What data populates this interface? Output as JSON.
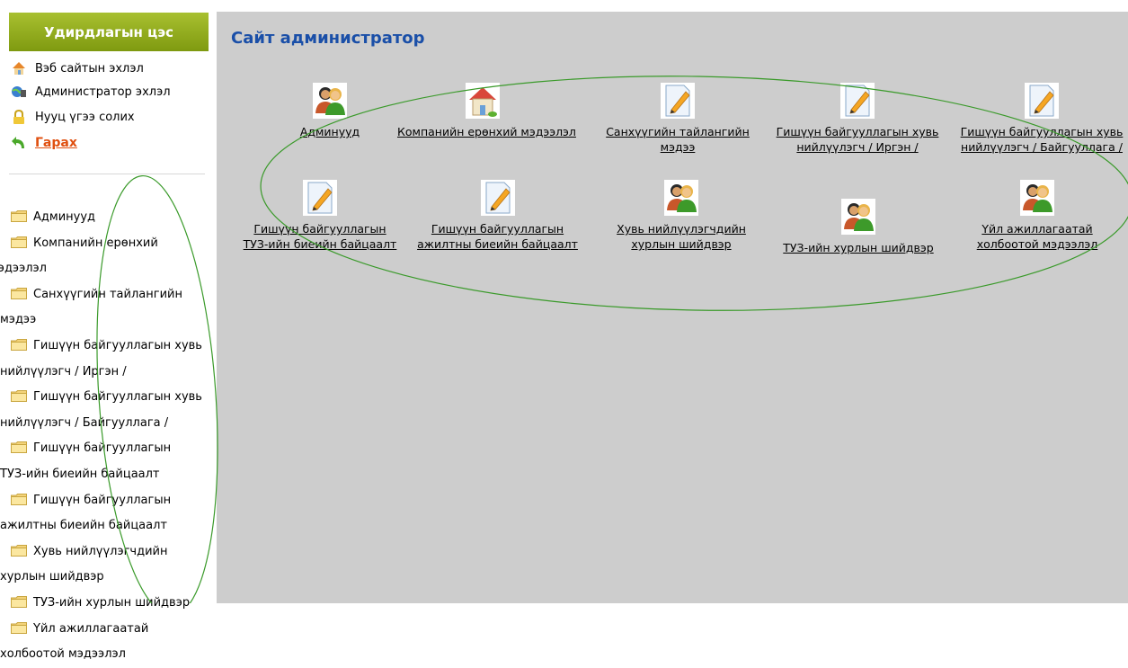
{
  "sidebar": {
    "title": "Удирдлагын цэс",
    "quick_links": [
      {
        "label": "Вэб сайтын эхлэл",
        "icon": "home-icon"
      },
      {
        "label": "Администратор эхлэл",
        "icon": "globe-icon"
      },
      {
        "label": "Нууц үгээ солих",
        "icon": "lock-icon"
      },
      {
        "label": "Гарах",
        "icon": "logout-arrow-icon"
      }
    ],
    "tree": [
      {
        "line1": "Админууд",
        "line2": ""
      },
      {
        "line1": "Компанийн ерөнхий",
        "line2": "мэдээлэл"
      },
      {
        "line1": "Санхүүгийн тайлангийн",
        "line2": "мэдээ"
      },
      {
        "line1": "Гишүүн байгууллагын хувь",
        "line2": "нийлүүлэгч / Иргэн /"
      },
      {
        "line1": "Гишүүн байгууллагын хувь",
        "line2": "нийлүүлэгч / Байгууллага /"
      },
      {
        "line1": "Гишүүн байгууллагын",
        "line2": "ТУЗ-ийн биеийн байцаалт"
      },
      {
        "line1": "Гишүүн байгууллагын",
        "line2": "ажилтны биеийн байцаалт"
      },
      {
        "line1": "Хувь нийлүүлэгчдийн",
        "line2": "хурлын шийдвэр"
      },
      {
        "line1": "ТУЗ-ийн хурлын шийдвэр",
        "line2": ""
      },
      {
        "line1": "Үйл ажиллагаатай",
        "line2": "холбоотой мэдээлэл"
      }
    ]
  },
  "main": {
    "title": "Сайт администратор",
    "items": [
      {
        "line1": "Админууд",
        "line2": "",
        "icon": "users-icon"
      },
      {
        "line1": "Компанийн ерөнхий мэдээлэл",
        "line2": "",
        "icon": "house-icon"
      },
      {
        "line1": "Санхүүгийн тайлангийн",
        "line2": "мэдээ",
        "icon": "document-edit-icon"
      },
      {
        "line1": "Гишүүн байгууллагын хувь",
        "line2": "нийлүүлэгч / Иргэн /",
        "icon": "document-edit-icon"
      },
      {
        "line1": "Гишүүн байгууллагын хувь",
        "line2": "нийлүүлэгч / Байгууллага /",
        "icon": "document-edit-icon"
      },
      {
        "line1": "Гишүүн байгууллагын",
        "line2": "ТУЗ-ийн биеийн байцаалт",
        "icon": "document-edit-icon"
      },
      {
        "line1": "Гишүүн байгууллагын",
        "line2": "ажилтны биеийн байцаалт",
        "icon": "document-edit-icon"
      },
      {
        "line1": "Хувь нийлүүлэгчдийн",
        "line2": "хурлын шийдвэр",
        "icon": "users-icon"
      },
      {
        "line1": "ТУЗ-ийн хурлын шийдвэр",
        "line2": "",
        "icon": "users-icon"
      },
      {
        "line1": "Үйл ажиллагаатай",
        "line2": "холбоотой мэдээлэл",
        "icon": "users-icon"
      }
    ]
  }
}
